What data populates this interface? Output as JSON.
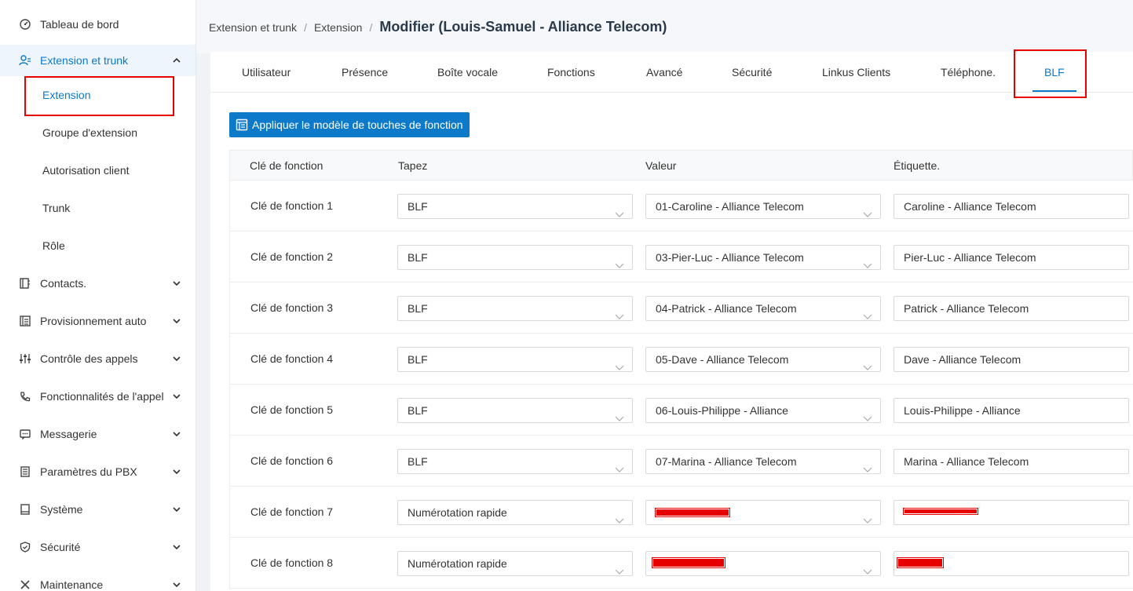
{
  "sidebar": {
    "items": [
      {
        "label": "Tableau de bord",
        "icon": "dashboard-icon"
      },
      {
        "label": "Extension et trunk",
        "icon": "users-icon",
        "open": true,
        "children": [
          "Extension",
          "Groupe d'extension",
          "Autorisation client",
          "Trunk",
          "Rôle"
        ]
      },
      {
        "label": "Contacts.",
        "icon": "contacts-icon"
      },
      {
        "label": "Provisionnement auto",
        "icon": "provisioning-icon"
      },
      {
        "label": "Contrôle des appels",
        "icon": "sliders-icon"
      },
      {
        "label": "Fonctionnalités de l'appel",
        "icon": "phone-icon"
      },
      {
        "label": "Messagerie",
        "icon": "message-icon"
      },
      {
        "label": "Paramètres du PBX",
        "icon": "pbx-settings-icon"
      },
      {
        "label": "Système",
        "icon": "system-icon"
      },
      {
        "label": "Sécurité",
        "icon": "shield-icon"
      },
      {
        "label": "Maintenance",
        "icon": "tools-icon"
      }
    ]
  },
  "breadcrumb": {
    "level1": "Extension et trunk",
    "level2": "Extension",
    "current": "Modifier (Louis-Samuel - Alliance Telecom)",
    "separator": "/"
  },
  "tabs": [
    "Utilisateur",
    "Présence",
    "Boîte vocale",
    "Fonctions",
    "Avancé",
    "Sécurité",
    "Linkus Clients",
    "Téléphone.",
    "BLF"
  ],
  "active_tab": "BLF",
  "apply_button": "Appliquer le modèle de touches de fonction",
  "table": {
    "headers": [
      "Clé de fonction",
      "Tapez",
      "Valeur",
      "Étiquette."
    ],
    "rows": [
      {
        "key": "Clé de fonction 1",
        "type": "BLF",
        "value": "01-Caroline - Alliance Telecom",
        "label": "Caroline - Alliance Telecom"
      },
      {
        "key": "Clé de fonction 2",
        "type": "BLF",
        "value": "03-Pier-Luc - Alliance Telecom",
        "label": "Pier-Luc - Alliance Telecom"
      },
      {
        "key": "Clé de fonction 3",
        "type": "BLF",
        "value": "04-Patrick - Alliance Telecom",
        "label": "Patrick - Alliance Telecom"
      },
      {
        "key": "Clé de fonction 4",
        "type": "BLF",
        "value": "05-Dave - Alliance Telecom",
        "label": "Dave - Alliance Telecom"
      },
      {
        "key": "Clé de fonction 5",
        "type": "BLF",
        "value": "06-Louis-Philippe - Alliance",
        "label": "Louis-Philippe - Alliance"
      },
      {
        "key": "Clé de fonction 6",
        "type": "BLF",
        "value": "07-Marina - Alliance Telecom",
        "label": "Marina - Alliance Telecom"
      },
      {
        "key": "Clé de fonction 7",
        "type": "Numérotation rapide",
        "value": "",
        "label": ""
      },
      {
        "key": "Clé de fonction 8",
        "type": "Numérotation rapide",
        "value": "",
        "label": ""
      }
    ]
  },
  "colors": {
    "accent": "#0c79c9",
    "highlight_box": "#e60000"
  }
}
